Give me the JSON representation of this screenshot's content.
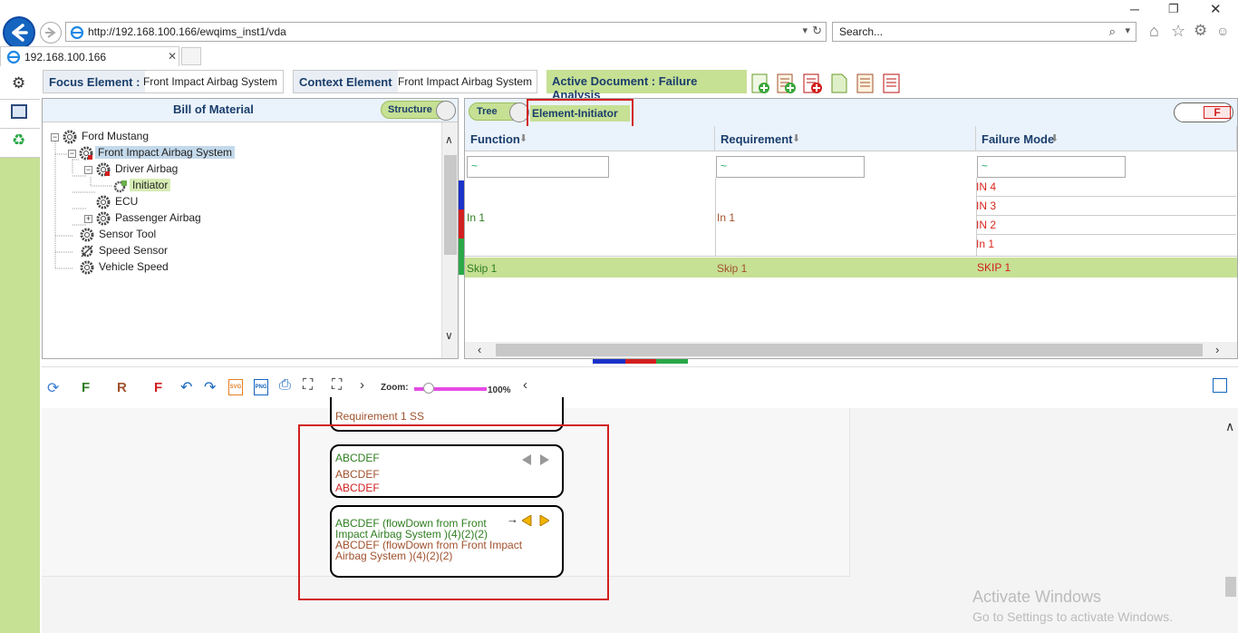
{
  "browser": {
    "url": "http://192.168.100.166/ewqims_inst1/vda",
    "search_placeholder": "Search...",
    "tab_title": "192.168.100.166"
  },
  "header": {
    "focus_label": "Focus Element :",
    "focus_value": "Front Impact Airbag System",
    "context_label": "Context Element",
    "context_value": "Front Impact Airbag System",
    "active_doc": "Active Document : Failure Analysis"
  },
  "bom": {
    "title": "Bill of Material",
    "toggle": "Structure",
    "tree": [
      {
        "label": "Ford Mustang"
      },
      {
        "label": "Front Impact Airbag System"
      },
      {
        "label": "Driver Airbag"
      },
      {
        "label": "Initiator"
      },
      {
        "label": "ECU"
      },
      {
        "label": "Passenger Airbag"
      },
      {
        "label": "Sensor Tool"
      },
      {
        "label": "Speed Sensor"
      },
      {
        "label": "Vehicle Speed"
      }
    ]
  },
  "grid": {
    "tree_toggle": "Tree",
    "view_title": "Element-Initiator",
    "f_button": "F",
    "columns": [
      "Function",
      "Requirement",
      "Failure Mode"
    ],
    "filter": "~",
    "rows": [
      {
        "function": "In 1",
        "requirement": "In 1",
        "failure_modes": [
          "IN 4",
          "IN 3",
          "IN 2",
          "In 1"
        ]
      },
      {
        "function": "Skip 1",
        "requirement": "Skip 1",
        "failure_modes": [
          "SKIP 1"
        ]
      }
    ]
  },
  "toolbar": {
    "f_green": "F",
    "r_brown": "R",
    "f_red": "F",
    "zoom_label": "Zoom:",
    "zoom_value": "100%"
  },
  "canvas": {
    "card0_text": "Requirement 1 SS",
    "card1": [
      "ABCDEF",
      "ABCDEF",
      "ABCDEF"
    ],
    "card2": [
      "ABCDEF (flowDown from Front",
      "Impact Airbag System )(4)(2)(2)",
      "ABCDEF (flowDown from Front Impact",
      "Airbag System )(4)(2)(2)"
    ]
  },
  "watermark": {
    "line1": "Activate Windows",
    "line2": "Go to Settings to activate Windows."
  }
}
